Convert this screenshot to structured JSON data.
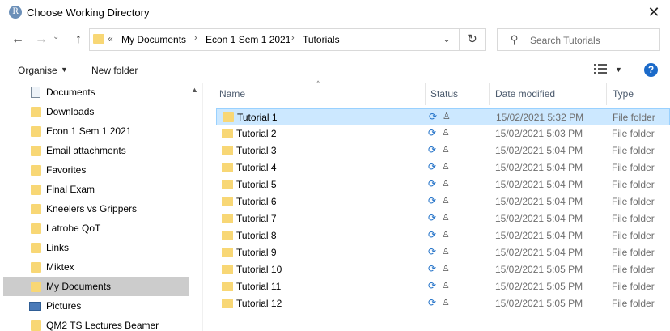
{
  "window": {
    "title": "Choose Working Directory",
    "app_icon_letter": "R",
    "close_glyph": "✕"
  },
  "nav": {
    "back": "←",
    "forward": "→",
    "up_caret": "⌄",
    "up": "↑",
    "refresh": "↻"
  },
  "address": {
    "chevrons": "«",
    "crumbs": [
      "My Documents",
      "Econ 1 Sem 1 2021",
      "Tutorials"
    ],
    "sep": "›",
    "dropdown": "⌄"
  },
  "search": {
    "placeholder": "Search Tutorials",
    "icon": "⚲"
  },
  "toolbar": {
    "organise": "Organise",
    "organise_caret": "▼",
    "new_folder": "New folder",
    "view_caret": "▼",
    "help": "?"
  },
  "sidebar": {
    "scroll_up": "▲",
    "items": [
      {
        "label": "Documents",
        "icon": "document-icon"
      },
      {
        "label": "Downloads",
        "icon": "folder-icon"
      },
      {
        "label": "Econ 1 Sem 1 2021",
        "icon": "folder-icon"
      },
      {
        "label": "Email attachments",
        "icon": "folder-icon"
      },
      {
        "label": "Favorites",
        "icon": "folder-icon"
      },
      {
        "label": "Final Exam",
        "icon": "folder-icon"
      },
      {
        "label": "Kneelers vs Grippers",
        "icon": "folder-icon"
      },
      {
        "label": "Latrobe QoT",
        "icon": "folder-icon"
      },
      {
        "label": "Links",
        "icon": "folder-icon"
      },
      {
        "label": "Miktex",
        "icon": "folder-icon"
      },
      {
        "label": "My Documents",
        "icon": "folder-icon",
        "selected": true
      },
      {
        "label": "Pictures",
        "icon": "pictures-icon"
      },
      {
        "label": "QM2 TS Lectures Beamer",
        "icon": "folder-icon"
      }
    ]
  },
  "columns": {
    "name": "Name",
    "status": "Status",
    "date": "Date modified",
    "type": "Type",
    "sort_caret": "^"
  },
  "status_glyphs": {
    "sync": "⟳",
    "person": "♙"
  },
  "files": [
    {
      "name": "Tutorial 1",
      "date": "15/02/2021 5:32 PM",
      "type": "File folder",
      "selected": true
    },
    {
      "name": "Tutorial 2",
      "date": "15/02/2021 5:03 PM",
      "type": "File folder"
    },
    {
      "name": "Tutorial 3",
      "date": "15/02/2021 5:04 PM",
      "type": "File folder"
    },
    {
      "name": "Tutorial 4",
      "date": "15/02/2021 5:04 PM",
      "type": "File folder"
    },
    {
      "name": "Tutorial 5",
      "date": "15/02/2021 5:04 PM",
      "type": "File folder"
    },
    {
      "name": "Tutorial 6",
      "date": "15/02/2021 5:04 PM",
      "type": "File folder"
    },
    {
      "name": "Tutorial 7",
      "date": "15/02/2021 5:04 PM",
      "type": "File folder"
    },
    {
      "name": "Tutorial 8",
      "date": "15/02/2021 5:04 PM",
      "type": "File folder"
    },
    {
      "name": "Tutorial 9",
      "date": "15/02/2021 5:04 PM",
      "type": "File folder"
    },
    {
      "name": "Tutorial 10",
      "date": "15/02/2021 5:05 PM",
      "type": "File folder"
    },
    {
      "name": "Tutorial 11",
      "date": "15/02/2021 5:05 PM",
      "type": "File folder"
    },
    {
      "name": "Tutorial 12",
      "date": "15/02/2021 5:05 PM",
      "type": "File folder"
    }
  ]
}
